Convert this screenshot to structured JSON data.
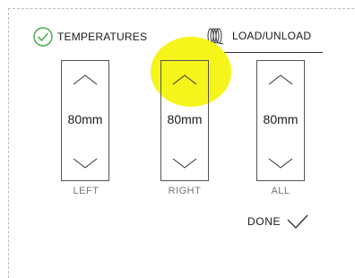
{
  "tabs": {
    "temperatures": {
      "label": "TEMPERATURES",
      "icon": "check-circle-icon",
      "completed": true
    },
    "load_unload": {
      "label": "LOAD/UNLOAD",
      "icon": "filament-coil-icon",
      "active": true
    }
  },
  "steppers": {
    "left": {
      "value": "80mm",
      "caption": "LEFT"
    },
    "right": {
      "value": "80mm",
      "caption": "RIGHT"
    },
    "all": {
      "value": "80mm",
      "caption": "ALL"
    }
  },
  "done": {
    "label": "DONE",
    "icon": "checkmark-icon"
  },
  "colors": {
    "accent": "#4caf50",
    "highlight": "#f5f51c",
    "text": "#1a1a1a",
    "caption": "#777777"
  }
}
